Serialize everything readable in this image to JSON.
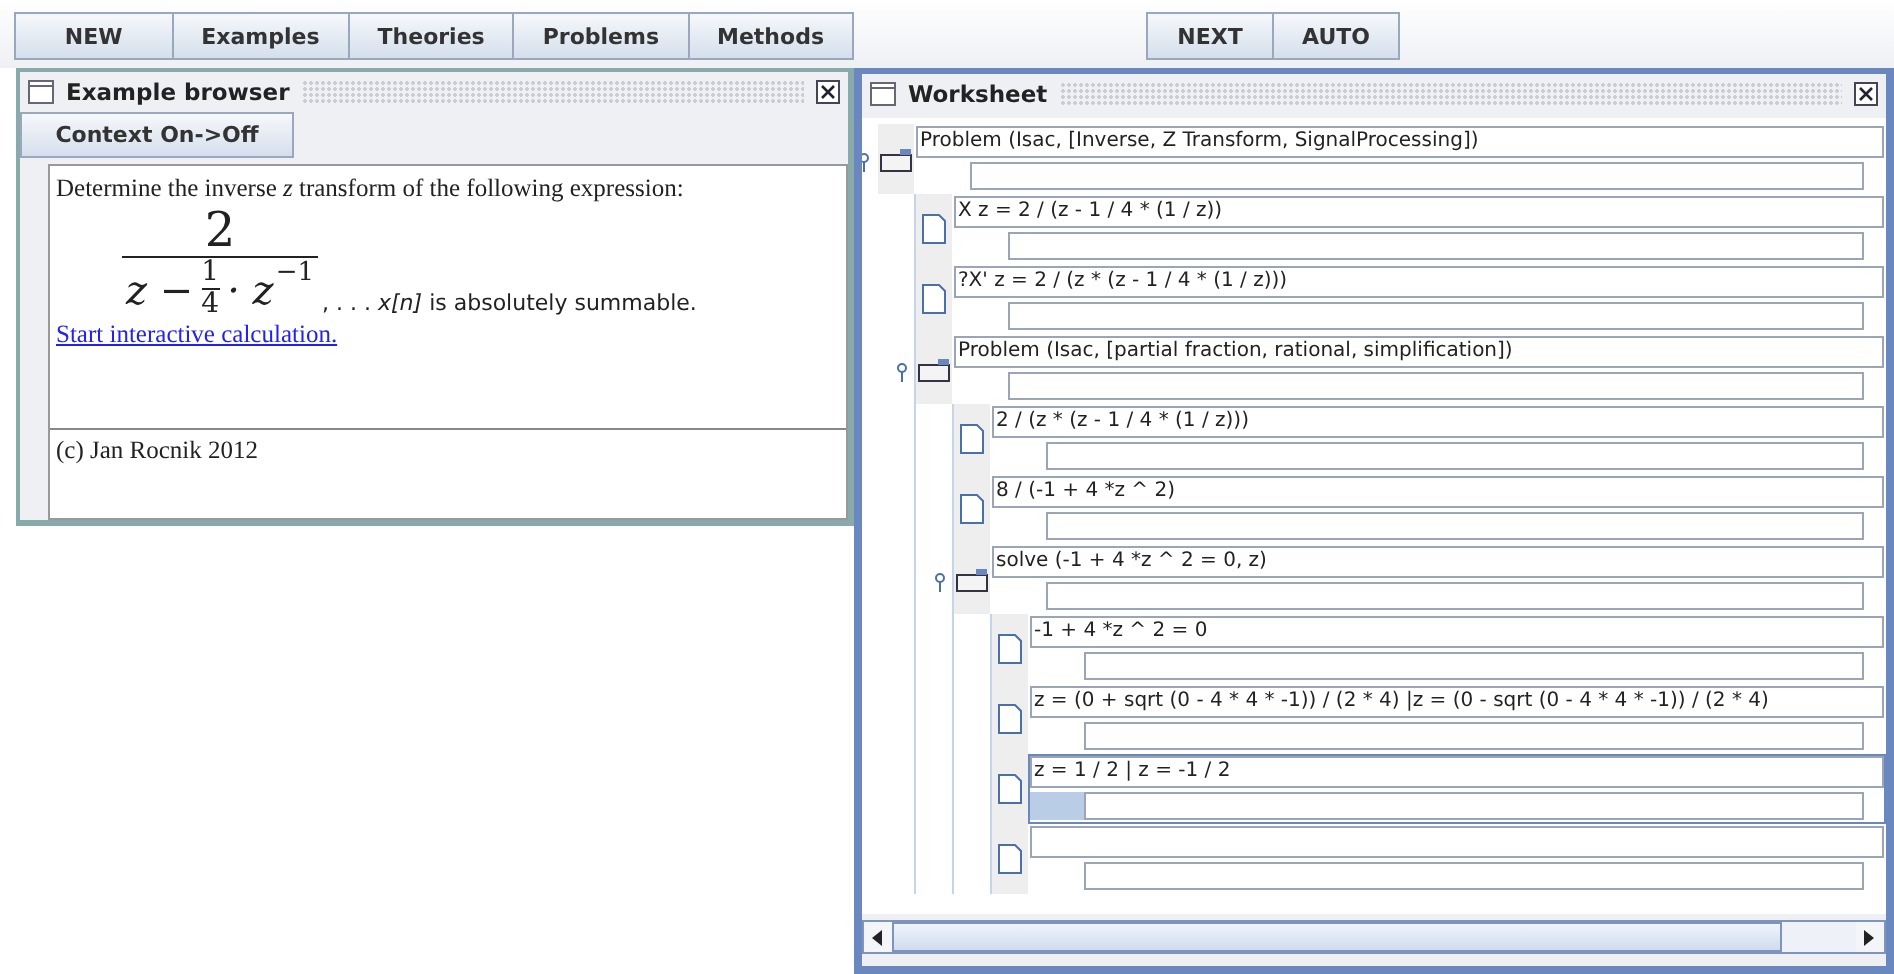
{
  "toolbar": {
    "left_buttons": [
      "NEW",
      "Examples",
      "Theories",
      "Problems",
      "Methods"
    ],
    "right_buttons": [
      "NEXT",
      "AUTO"
    ]
  },
  "example_browser": {
    "title": "Example browser",
    "context_button": "Context On->Off",
    "description": "Determine the inverse *z* transform of the following expression:",
    "formula": {
      "numerator": "2",
      "den_lead": "z −",
      "den_frac_num": "1",
      "den_frac_den": "4",
      "den_tail": "· z",
      "den_exponent": "−1"
    },
    "formula_suffix": ", . . . *x[n]* is absolutely summable.",
    "link": "Start interactive calculation.",
    "footer": "(c)  Jan Rocnik 2012"
  },
  "worksheet": {
    "title": "Worksheet",
    "tree": [
      {
        "kind": "problem",
        "formula": "Problem (Isac, [Inverse, Z Transform, SignalProcessing])",
        "selected": false,
        "expanded": true,
        "children": [
          {
            "kind": "step",
            "formula": "X z = 2 / (z - 1 / 4 * (1 / z))",
            "selected": false
          },
          {
            "kind": "step",
            "formula": "?X' z = 2 / (z * (z - 1 / 4 * (1 / z)))",
            "selected": false
          },
          {
            "kind": "problem",
            "formula": "Problem (Isac, [partial fraction, rational, simplification])",
            "selected": false,
            "expanded": true,
            "children": [
              {
                "kind": "step",
                "formula": "2 / (z * (z - 1 / 4 * (1 / z)))",
                "selected": false
              },
              {
                "kind": "step",
                "formula": "8 / (-1 + 4 *z ^ 2)",
                "selected": false
              },
              {
                "kind": "problem",
                "formula": "solve (-1 + 4 *z ^ 2 = 0, z)",
                "selected": false,
                "expanded": true,
                "children": [
                  {
                    "kind": "step",
                    "formula": "-1 + 4 *z ^ 2 = 0",
                    "selected": false
                  },
                  {
                    "kind": "step",
                    "formula": "z = (0 + sqrt (0 - 4 * 4 * -1)) / (2 * 4) |z = (0 - sqrt (0 - 4 * 4 * -1)) / (2 * 4)",
                    "selected": false
                  },
                  {
                    "kind": "step",
                    "formula": "z = 1 / 2 | z = -1 / 2",
                    "selected": true
                  },
                  {
                    "kind": "step",
                    "selected": false
                  }
                ]
              }
            ]
          }
        ]
      }
    ]
  }
}
